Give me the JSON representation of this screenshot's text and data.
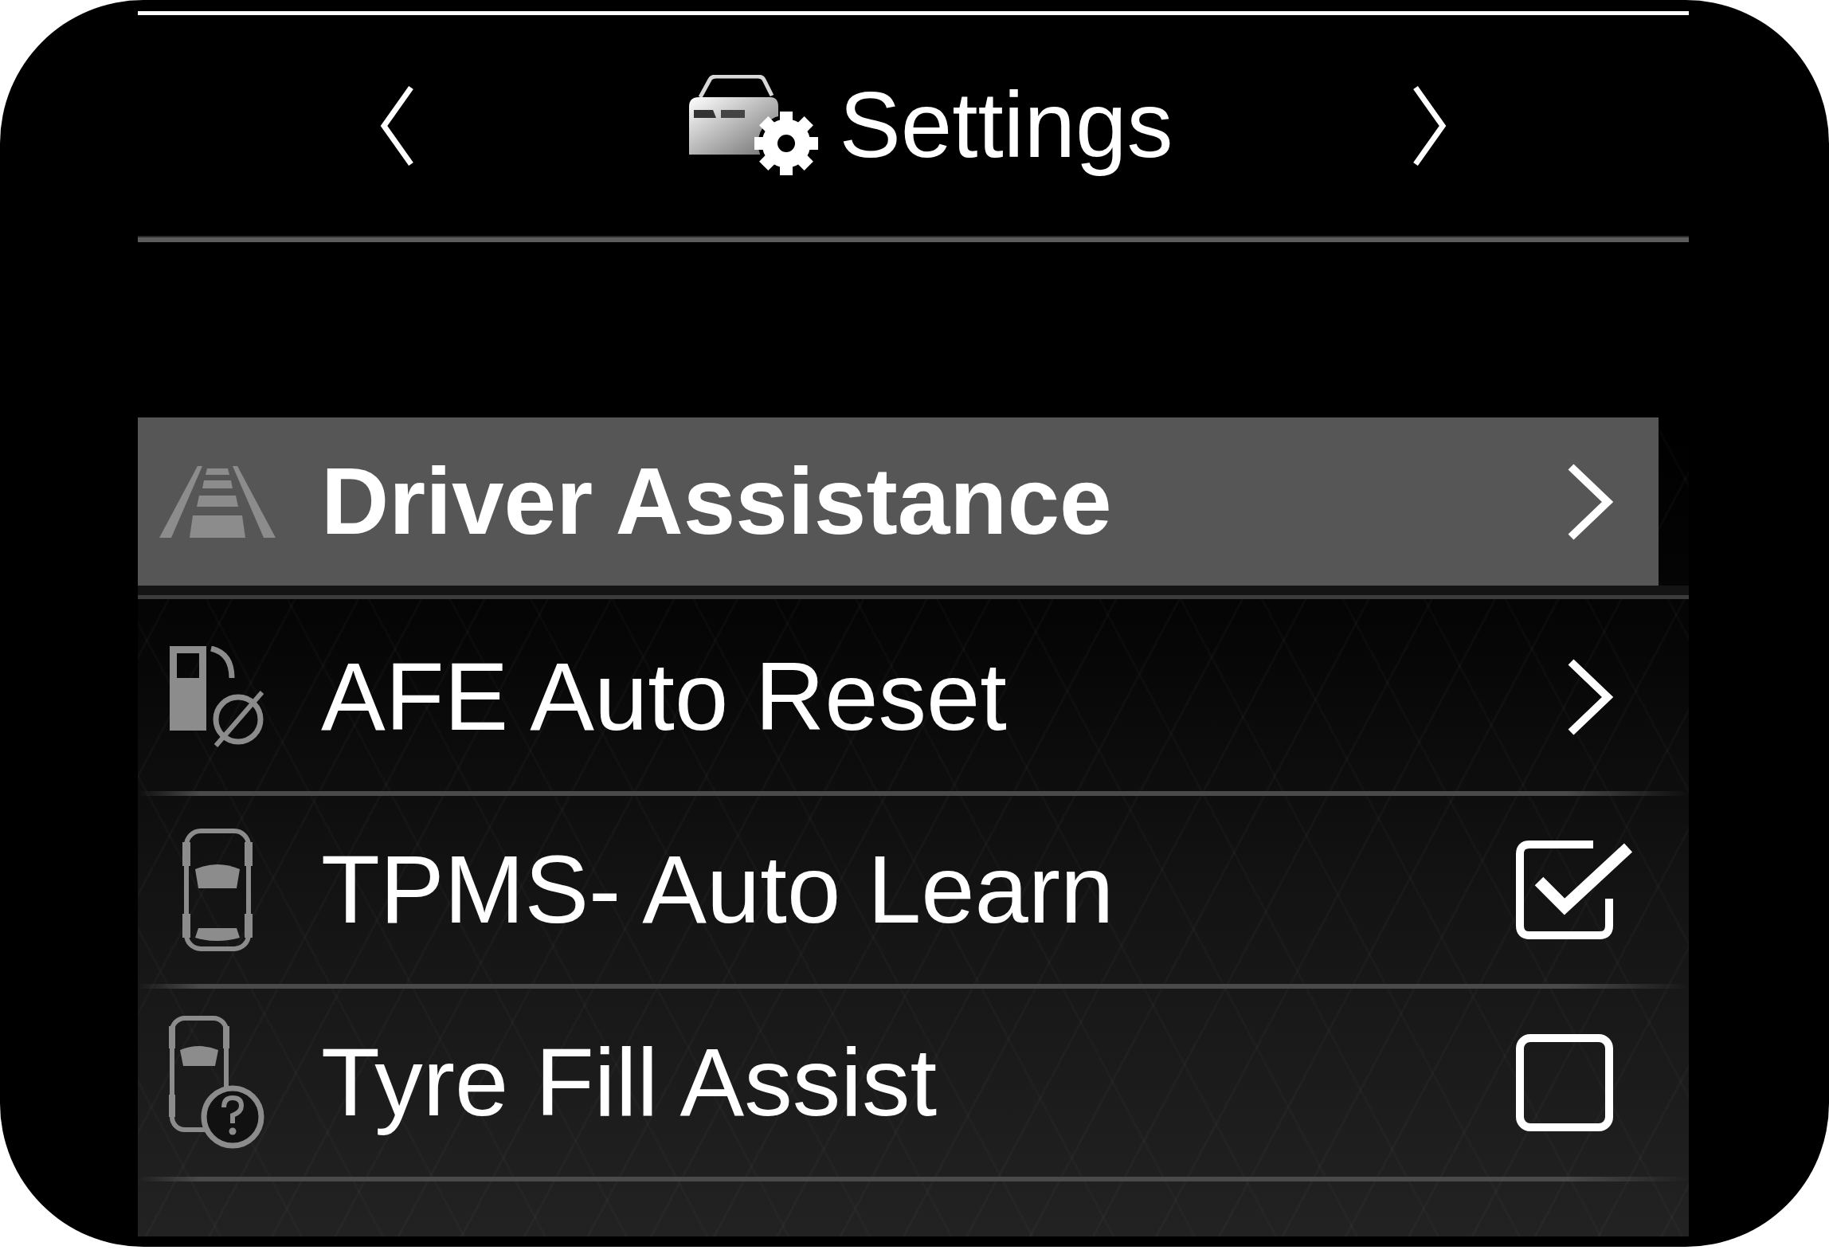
{
  "header": {
    "title": "Settings"
  },
  "menu": {
    "items": [
      {
        "label": "Driver Assistance",
        "kind": "submenu",
        "selected": true
      },
      {
        "label": "AFE Auto Reset",
        "kind": "submenu",
        "selected": false
      },
      {
        "label": "TPMS- Auto Learn",
        "kind": "toggle",
        "checked": true,
        "selected": false
      },
      {
        "label": "Tyre Fill Assist",
        "kind": "toggle",
        "checked": false,
        "selected": false
      }
    ]
  }
}
